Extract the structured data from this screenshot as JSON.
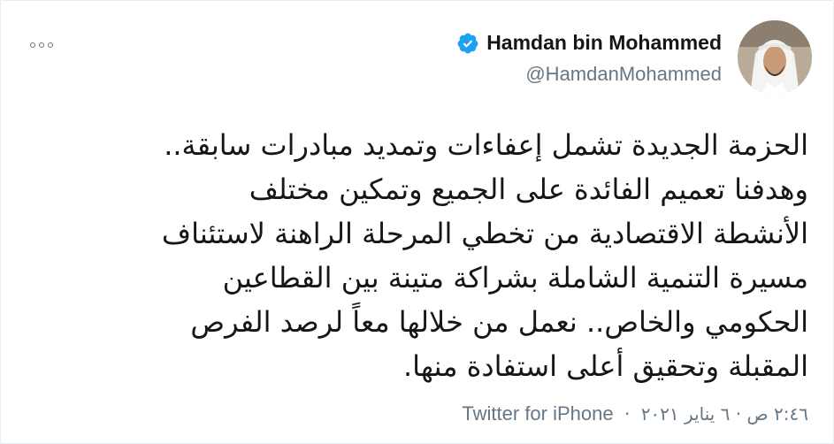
{
  "tweet": {
    "author": {
      "display_name": "Hamdan bin Mohammed",
      "handle": "@HamdanMohammed",
      "verified": true,
      "avatar_icon": "profile-photo"
    },
    "text_lines": [
      "الحزمة الجديدة تشمل إعفاءات وتمديد مبادرات سابقة..",
      "وهدفنا تعميم الفائدة على الجميع وتمكين مختلف",
      "الأنشطة الاقتصادية من تخطي المرحلة الراهنة لاستئناف",
      "مسيرة التنمية الشاملة بشراكة متينة بين القطاعين",
      "الحكومي والخاص.. نعمل من خلالها معاً لرصد الفرص",
      "المقبلة وتحقيق أعلى استفادة منها."
    ],
    "timestamp": "٢:٤٦ ص · ٦ يناير ٢٠٢١",
    "separator": "·",
    "source": "Twitter for iPhone"
  },
  "icons": {
    "more": "more-options-icon",
    "verified": "verified-badge-icon"
  },
  "colors": {
    "text_primary": "#14171a",
    "text_secondary": "#657786",
    "verified_blue": "#1da1f2",
    "border": "#e6ecf0"
  }
}
